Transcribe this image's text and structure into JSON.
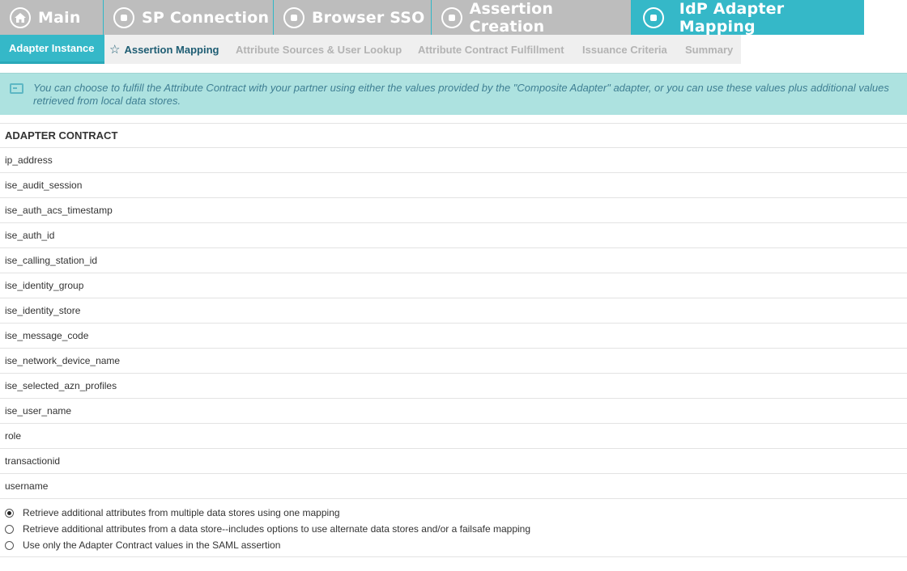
{
  "top_tabs": [
    {
      "label": "Main",
      "icon": "home-icon"
    },
    {
      "label": "SP Connection",
      "icon": "step-icon"
    },
    {
      "label": "Browser SSO",
      "icon": "step-icon"
    },
    {
      "label": "Assertion Creation",
      "icon": "step-icon"
    },
    {
      "label": "IdP Adapter Mapping",
      "icon": "step-icon",
      "active": true
    }
  ],
  "sub_tabs": [
    {
      "label": "Adapter Instance",
      "state": "active"
    },
    {
      "label": "Assertion Mapping",
      "state": "current"
    },
    {
      "label": "Attribute Sources & User Lookup",
      "state": "disabled"
    },
    {
      "label": "Attribute Contract Fulfillment",
      "state": "disabled"
    },
    {
      "label": "Issuance Criteria",
      "state": "disabled"
    },
    {
      "label": "Summary",
      "state": "disabled"
    }
  ],
  "info": {
    "icon": "info-window-icon",
    "text": "You can choose to fulfill the Attribute Contract with your partner using either the values provided by the \"Composite Adapter\" adapter, or you can use these values plus additional values retrieved from local data stores."
  },
  "table": {
    "header": "ADAPTER CONTRACT",
    "rows": [
      "ip_address",
      "ise_audit_session",
      "ise_auth_acs_timestamp",
      "ise_auth_id",
      "ise_calling_station_id",
      "ise_identity_group",
      "ise_identity_store",
      "ise_message_code",
      "ise_network_device_name",
      "ise_selected_azn_profiles",
      "ise_user_name",
      "role",
      "transactionid",
      "username"
    ]
  },
  "options": [
    {
      "label": "Retrieve additional attributes from multiple data stores using one mapping",
      "selected": true
    },
    {
      "label": "Retrieve additional attributes from a data store--includes options to use alternate data stores and/or a failsafe mapping",
      "selected": false
    },
    {
      "label": "Use only the Adapter Contract values in the SAML assertion",
      "selected": false
    }
  ],
  "colors": {
    "accent": "#35b8c8",
    "inactive_tab": "#bdbdbd",
    "banner": "#ade2e0"
  }
}
